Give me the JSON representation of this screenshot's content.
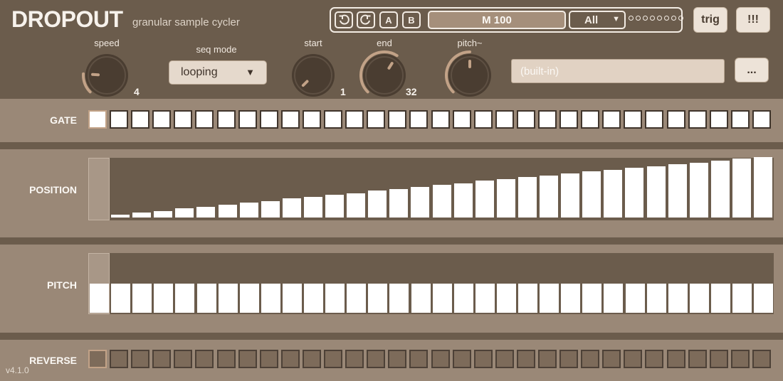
{
  "app": {
    "name": "DROPOUT",
    "subtitle": "granular sample cycler",
    "version": "v4.1.0"
  },
  "transport": {
    "undo_icon": "undo-icon",
    "redo_icon": "redo-icon",
    "a_label": "A",
    "b_label": "B",
    "preset_label": "M 100",
    "scope_value": "All",
    "scope_caret": "▼",
    "dot_count": 8
  },
  "header_buttons": {
    "trig_label": "trig",
    "panic_label": "!!!"
  },
  "controls": {
    "speed": {
      "label": "speed",
      "value": "4",
      "fraction": 0.18
    },
    "seq_mode": {
      "label": "seq mode",
      "value": "looping",
      "caret": "▼"
    },
    "start": {
      "label": "start",
      "value": "1",
      "fraction": 0.0
    },
    "end": {
      "label": "end",
      "value": "32",
      "fraction": 0.62
    },
    "pitch": {
      "label": "pitch~",
      "fraction": 0.5
    }
  },
  "sample": {
    "value": "(built-in)",
    "browse_label": "..."
  },
  "lanes": {
    "gate": {
      "label": "GATE",
      "steps": 32,
      "current": 0
    },
    "position": {
      "label": "POSITION",
      "values": [
        0.02,
        0.05,
        0.08,
        0.11,
        0.15,
        0.18,
        0.21,
        0.24,
        0.27,
        0.31,
        0.34,
        0.37,
        0.4,
        0.44,
        0.47,
        0.5,
        0.53,
        0.56,
        0.6,
        0.63,
        0.66,
        0.69,
        0.72,
        0.75,
        0.78,
        0.81,
        0.84,
        0.87,
        0.9,
        0.93,
        0.96,
        0.99
      ]
    },
    "pitch": {
      "label": "PITCH",
      "values": [
        0.5,
        0.5,
        0.5,
        0.5,
        0.5,
        0.5,
        0.5,
        0.5,
        0.5,
        0.5,
        0.5,
        0.5,
        0.5,
        0.5,
        0.5,
        0.5,
        0.5,
        0.5,
        0.5,
        0.5,
        0.5,
        0.5,
        0.5,
        0.5,
        0.5,
        0.5,
        0.5,
        0.5,
        0.5,
        0.5,
        0.5,
        0.5
      ]
    },
    "reverse": {
      "label": "REVERSE",
      "steps": 32,
      "current": 0
    }
  },
  "colors": {
    "background": "#6b5c4c",
    "lane": "#9a8877",
    "accent": "#c2a287",
    "step_on": "#ffffff"
  }
}
